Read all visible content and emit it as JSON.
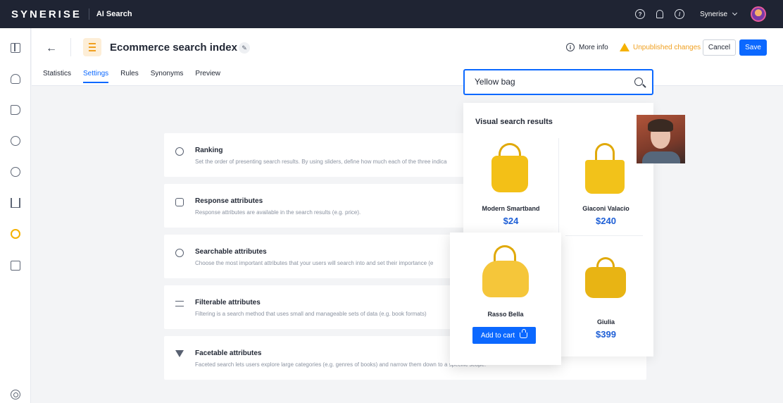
{
  "topbar": {
    "brand": "SYNERISE",
    "app_name": "AI Search",
    "workspace": "Synerise",
    "icons": [
      "help-icon",
      "bell-icon",
      "compass-icon"
    ]
  },
  "sidebar": {
    "items": [
      "dashboard-icon",
      "profile-icon",
      "campaign-icon",
      "loyalty-icon",
      "play-icon",
      "analytics-icon",
      "ai-search-icon",
      "assets-icon"
    ],
    "footer": "settings-icon"
  },
  "header": {
    "title": "Ecommerce search index",
    "more_info": "More info",
    "unpublished": "Unpublished changes",
    "cancel": "Cancel",
    "save": "Save",
    "tabs": [
      {
        "label": "Statistics",
        "active": false
      },
      {
        "label": "Settings",
        "active": true
      },
      {
        "label": "Rules",
        "active": false
      },
      {
        "label": "Synonyms",
        "active": false
      },
      {
        "label": "Preview",
        "active": false
      }
    ]
  },
  "cards": [
    {
      "title": "Ranking",
      "desc": "Set the order of presenting search results. By using sliders, define how much each of the three indica"
    },
    {
      "title": "Response attributes",
      "desc": "Response attributes are available in the search results (e.g. price)."
    },
    {
      "title": "Searchable attributes",
      "desc": "Choose the most important attributes that your users will search into and set their importance (e"
    },
    {
      "title": "Filterable attributes",
      "desc": "Filtering is a search method that uses small and manageable sets of data (e.g. book formats)"
    },
    {
      "title": "Facetable attributes",
      "desc": "Faceted search lets users explore large categories (e.g. genres of books) and narrow them down to a specific scope."
    }
  ],
  "search": {
    "value": "Yellow bag"
  },
  "results": {
    "title": "Visual search results",
    "products": [
      {
        "name": "Modern Smartband",
        "price": "$24"
      },
      {
        "name": "Giaconi Valacio",
        "price": "$240"
      },
      {
        "name": "Rasso Bella",
        "add_to_cart": "Add to cart"
      },
      {
        "name": "Giulia",
        "price": "$399"
      }
    ]
  },
  "colors": {
    "accent": "#0b68ff",
    "topbar": "#1f2433",
    "warning": "#f0a020",
    "price": "#1e5fd6"
  }
}
